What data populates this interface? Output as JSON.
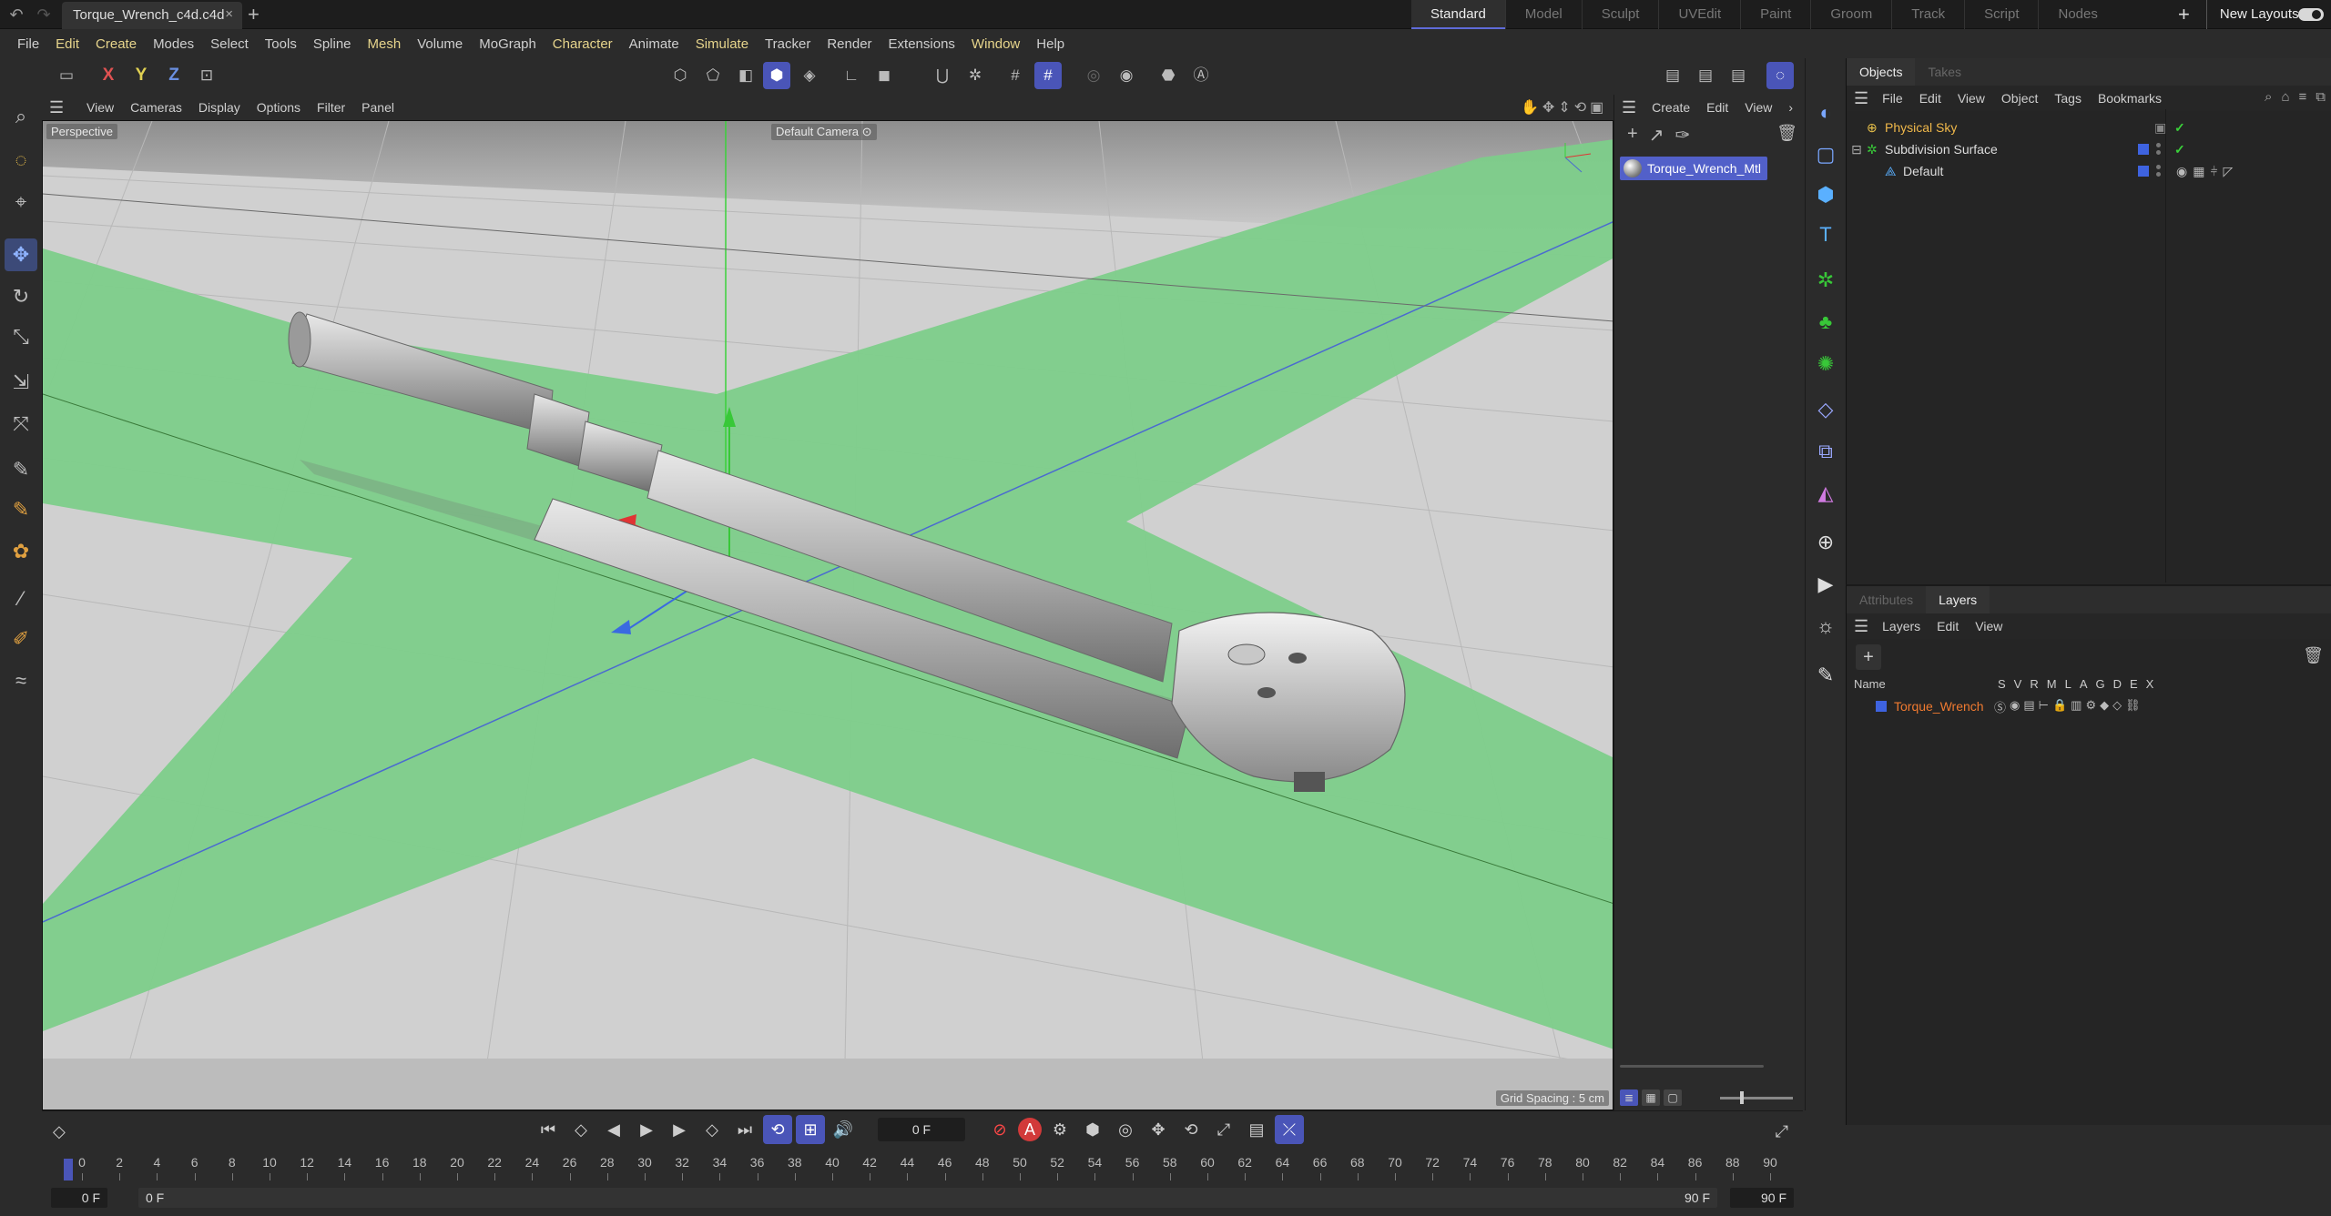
{
  "titlebar": {
    "doc_tab": "Torque_Wrench_c4d.c4d",
    "close": "×",
    "add": "+",
    "layouts": [
      "Standard",
      "Model",
      "Sculpt",
      "UVEdit",
      "Paint",
      "Groom",
      "Track",
      "Script",
      "Nodes"
    ],
    "active_layout": "Standard",
    "new_layouts_plus": "+",
    "new_layouts": "New Layouts"
  },
  "menu": [
    "File",
    "Edit",
    "Create",
    "Modes",
    "Select",
    "Tools",
    "Spline",
    "Mesh",
    "Volume",
    "MoGraph",
    "Character",
    "Animate",
    "Simulate",
    "Tracker",
    "Render",
    "Extensions",
    "Window",
    "Help"
  ],
  "menu_highlight": [
    "Edit",
    "Create",
    "Mesh",
    "Character",
    "Simulate",
    "Window"
  ],
  "toolbar": {
    "axis_x": "X",
    "axis_y": "Y",
    "axis_z": "Z",
    "colors": {
      "x": "#e05252",
      "y": "#e0d052",
      "z": "#6a8fe0"
    }
  },
  "viewport": {
    "menu": [
      "View",
      "Cameras",
      "Display",
      "Options",
      "Filter",
      "Panel"
    ],
    "perspective_label": "Perspective",
    "camera_label": "Default Camera",
    "camera_suffix": "⊙",
    "grid_spacing": "Grid Spacing : 5 cm",
    "ground_color": "#7dcd8a",
    "floor_color": "#d0d0d0"
  },
  "material_manager": {
    "menu": [
      "Create",
      "Edit",
      "View"
    ],
    "more": "›",
    "material": "Torque_Wrench_Mtl"
  },
  "objects_panel": {
    "tabs": [
      "Objects",
      "Takes"
    ],
    "menu": [
      "File",
      "Edit",
      "View",
      "Object",
      "Tags",
      "Bookmarks"
    ],
    "items": [
      {
        "name": "Physical Sky",
        "indent": 0
      },
      {
        "name": "Subdivision Surface",
        "indent": 0
      },
      {
        "name": "Default",
        "indent": 1
      }
    ]
  },
  "layers_panel": {
    "tabs": [
      "Attributes",
      "Layers"
    ],
    "menu": [
      "Layers",
      "Edit",
      "View"
    ],
    "name_header": "Name",
    "columns": [
      "S",
      "V",
      "R",
      "M",
      "L",
      "A",
      "G",
      "D",
      "E",
      "X"
    ],
    "layer": "Torque_Wrench"
  },
  "timeline": {
    "current_frame": "0 F",
    "start_field": "0 F",
    "start_field2": "0 F",
    "end_field": "90 F",
    "end_field2": "90 F",
    "ticks": [
      "0",
      "2",
      "4",
      "6",
      "8",
      "10",
      "12",
      "14",
      "16",
      "18",
      "20",
      "22",
      "24",
      "26",
      "28",
      "30",
      "32",
      "34",
      "36",
      "38",
      "40",
      "42",
      "44",
      "46",
      "48",
      "50",
      "52",
      "54",
      "56",
      "58",
      "60",
      "62",
      "64",
      "66",
      "68",
      "70",
      "72",
      "74",
      "76",
      "78",
      "80",
      "82",
      "84",
      "86",
      "88",
      "90"
    ],
    "autokey": "A"
  }
}
